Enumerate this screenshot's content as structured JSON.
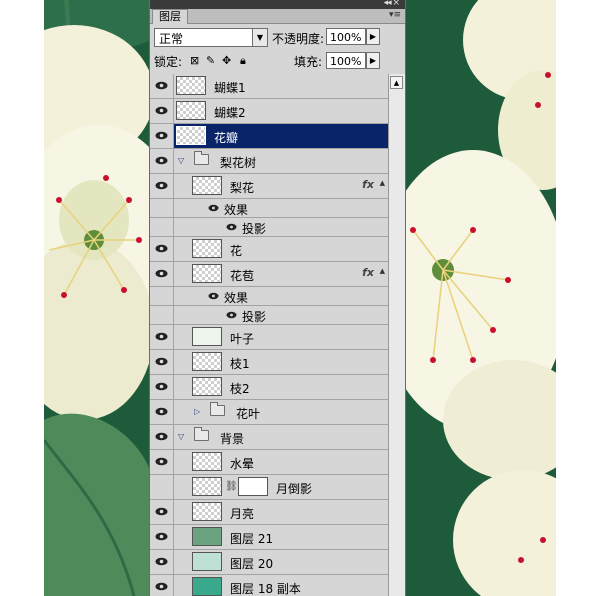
{
  "panel": {
    "tab_label": "图层",
    "blend_mode": "正常",
    "opacity_label": "不透明度:",
    "opacity_value": "100%",
    "lock_label": "锁定:",
    "fill_label": "填充:",
    "fill_value": "100%"
  },
  "layers": [
    {
      "name": "蝴蝶1"
    },
    {
      "name": "蝴蝶2"
    },
    {
      "name": "花瓣",
      "selected": true
    },
    {
      "name": "梨花树",
      "group": true
    },
    {
      "name": "梨花",
      "fx": "fx"
    },
    {
      "effect_header": "效果"
    },
    {
      "effect": "投影"
    },
    {
      "name": "花"
    },
    {
      "name": "花苞",
      "fx": "fx"
    },
    {
      "effect_header": "效果"
    },
    {
      "effect": "投影"
    },
    {
      "name": "叶子"
    },
    {
      "name": "枝1"
    },
    {
      "name": "枝2"
    },
    {
      "name": "花叶",
      "group": true,
      "collapsed": true
    },
    {
      "name": "背景",
      "group": true
    },
    {
      "name": "水晕"
    },
    {
      "name": "月倒影"
    },
    {
      "name": "月亮"
    },
    {
      "name": "图层 21"
    },
    {
      "name": "图层 20"
    },
    {
      "name": "图层 18 副本"
    }
  ],
  "labels": {
    "l0": "蝴蝶1",
    "l1": "蝴蝶2",
    "l2": "花瓣",
    "l3": "梨花树",
    "l4": "梨花",
    "e1": "效果",
    "e2": "投影",
    "l5": "花",
    "l6": "花苞",
    "e3": "效果",
    "e4": "投影",
    "l7": "叶子",
    "l8": "枝1",
    "l9": "枝2",
    "l10": "花叶",
    "l11": "背景",
    "l12": "水晕",
    "l13": "月倒影",
    "l14": "月亮",
    "l15": "图层 21",
    "l16": "图层 20",
    "l17": "图层 18 副本",
    "fx": "fx"
  },
  "colors": {
    "selection": "#0a246a",
    "panel": "#d6d6d6"
  }
}
